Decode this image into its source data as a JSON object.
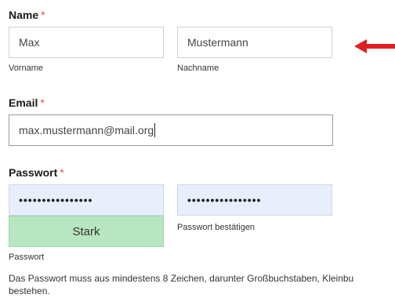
{
  "name_section": {
    "label": "Name",
    "required": "*",
    "first_name": {
      "value": "Max",
      "caption": "Vorname"
    },
    "last_name": {
      "value": "Mustermann",
      "caption": "Nachname"
    }
  },
  "email_section": {
    "label": "Email",
    "required": "*",
    "value": "max.mustermann@mail.org"
  },
  "password_section": {
    "label": "Passwort",
    "required": "*",
    "password_mask": "••••••••••••••••",
    "confirm_mask": "••••••••••••••••",
    "strength": "Stark",
    "password_caption": "Passwort",
    "confirm_caption": "Passwort bestätigen",
    "help_line1": "Das Passwort muss aus mindestens 8 Zeichen, darunter Großbuchstaben, Kleinbu",
    "help_line2": "bestehen."
  },
  "annotation": {
    "arrow_color": "#e02020",
    "icon": "arrow-left-icon"
  }
}
